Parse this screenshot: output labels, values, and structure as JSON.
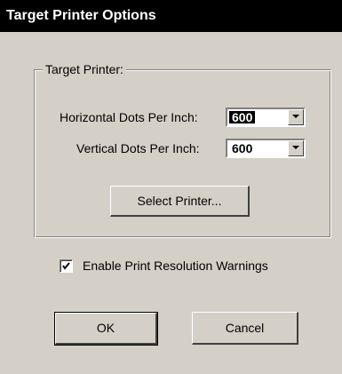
{
  "window": {
    "title": "Target Printer Options"
  },
  "group": {
    "label": "Target Printer:"
  },
  "horizontal": {
    "label": "Horizontal Dots Per Inch:",
    "value": "600"
  },
  "vertical": {
    "label": "Vertical Dots Per Inch:",
    "value": "600"
  },
  "select_printer": {
    "label": "Select Printer..."
  },
  "warnings": {
    "label": "Enable Print Resolution Warnings",
    "checked": true
  },
  "buttons": {
    "ok": "OK",
    "cancel": "Cancel"
  },
  "icons": {
    "dropdown": "chevron-down-icon",
    "check": "checkmark-icon"
  }
}
